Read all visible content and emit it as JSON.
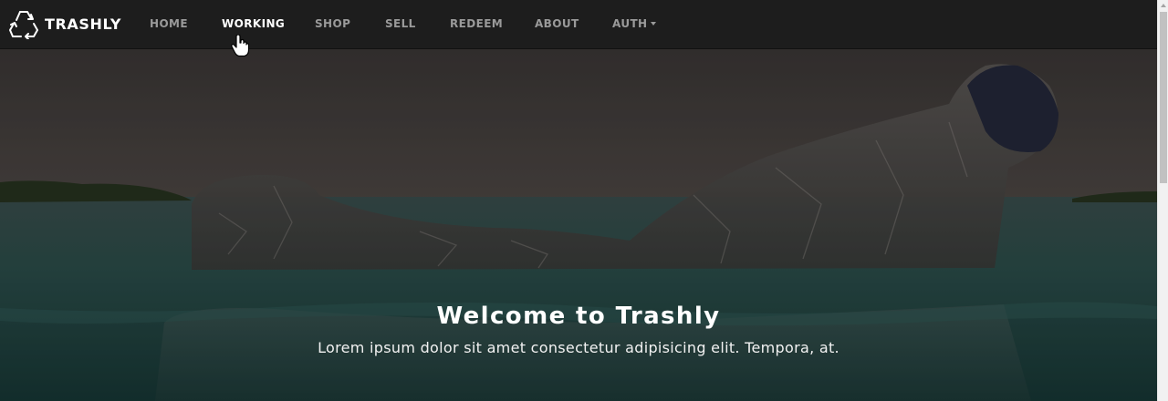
{
  "brand": {
    "name": "TRASHLY",
    "icon": "recycle-icon"
  },
  "nav": {
    "items": [
      {
        "label": "HOME"
      },
      {
        "label": "WORKING",
        "active": true
      },
      {
        "label": "SHOP"
      },
      {
        "label": "SELL"
      },
      {
        "label": "REDEEM"
      },
      {
        "label": "ABOUT"
      },
      {
        "label": "AUTH",
        "dropdown": true
      }
    ]
  },
  "hero": {
    "title": "Welcome to Trashly",
    "subtitle": "Lorem ipsum dolor sit amet consectetur adipisicing elit. Tempora, at.",
    "image": "plastic-bottle-in-ocean"
  },
  "colors": {
    "navbar": "#1d1d1d",
    "nav_link": "#9a9a9a",
    "nav_active": "#ffffff",
    "water": "#1f4442"
  },
  "cursor": "hand-pointer-icon"
}
